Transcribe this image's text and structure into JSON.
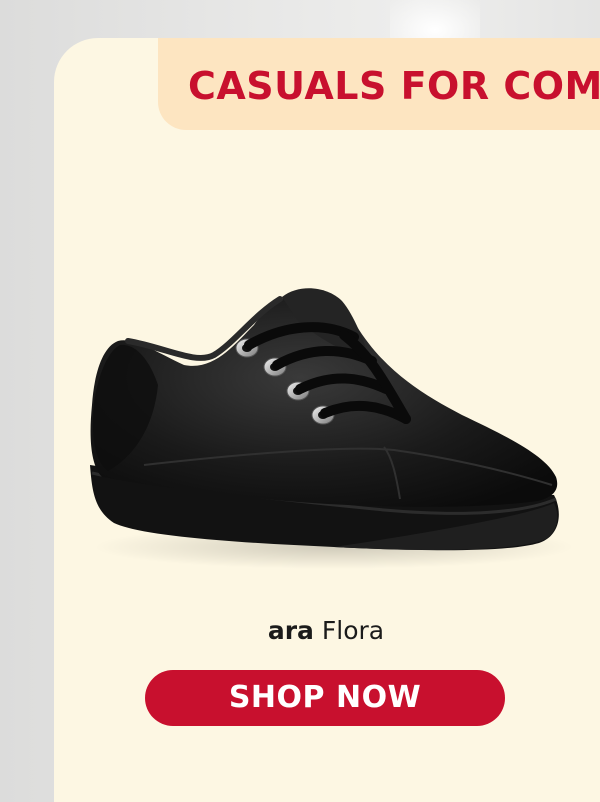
{
  "banner": {
    "text": "CASUALS FOR COMFORT"
  },
  "product": {
    "brand": "ara",
    "model": "Flora",
    "image_alt": "ara Flora black leather lace-up sneaker"
  },
  "cta": {
    "label": "SHOP NOW"
  },
  "colors": {
    "card_bg": "#fdf7e3",
    "banner_bg": "#fde5c1",
    "accent_red": "#c8102e",
    "page_bg": "#e2e2e1"
  }
}
